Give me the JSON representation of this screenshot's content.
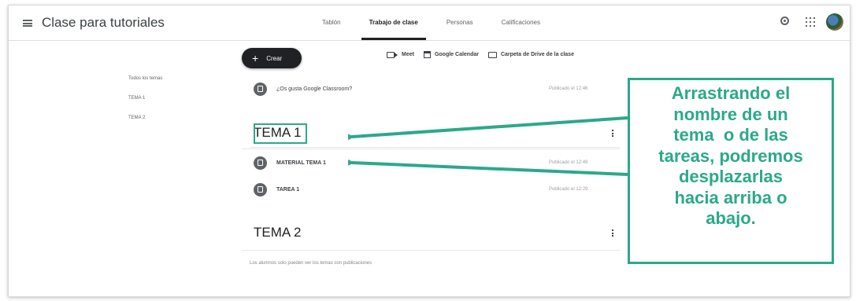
{
  "header": {
    "class_title": "Clase para tutoriales",
    "tabs": [
      {
        "label": "Tablón",
        "active": false
      },
      {
        "label": "Trabajo de clase",
        "active": true
      },
      {
        "label": "Personas",
        "active": false
      },
      {
        "label": "Calificaciones",
        "active": false
      }
    ]
  },
  "toolbar": {
    "create_label": "Crear",
    "meet_label": "Meet",
    "calendar_label": "Google Calendar",
    "drive_label": "Carpeta de Drive de la clase"
  },
  "topic_nav": {
    "items": [
      "Todos los temas",
      "TEMA 1",
      "TEMA 2"
    ]
  },
  "stream": {
    "intro_item": {
      "title": "¿Os gusta Google Classroom?",
      "date": "Publicado el 12:46"
    },
    "topics": [
      {
        "title": "TEMA 1",
        "items": [
          {
            "title": "MATERIAL TEMA 1",
            "date": "Publicado el 12:49"
          },
          {
            "title": "TAREA 1",
            "date": "Publicado el 12:29"
          }
        ]
      },
      {
        "title": "TEMA 2",
        "items": []
      }
    ],
    "empty_note": "Los alumnos solo pueden ver los temas con publicaciones"
  },
  "annotation": {
    "lines": [
      "Arrastrando el",
      "nombre de un",
      "tema  o de las",
      "tareas, podremos",
      "desplazarlas",
      "hacia arriba o",
      "abajo."
    ],
    "color": "#2ba98a"
  },
  "colors": {
    "accent": "#2ba98a",
    "primary_button": "#202124"
  }
}
